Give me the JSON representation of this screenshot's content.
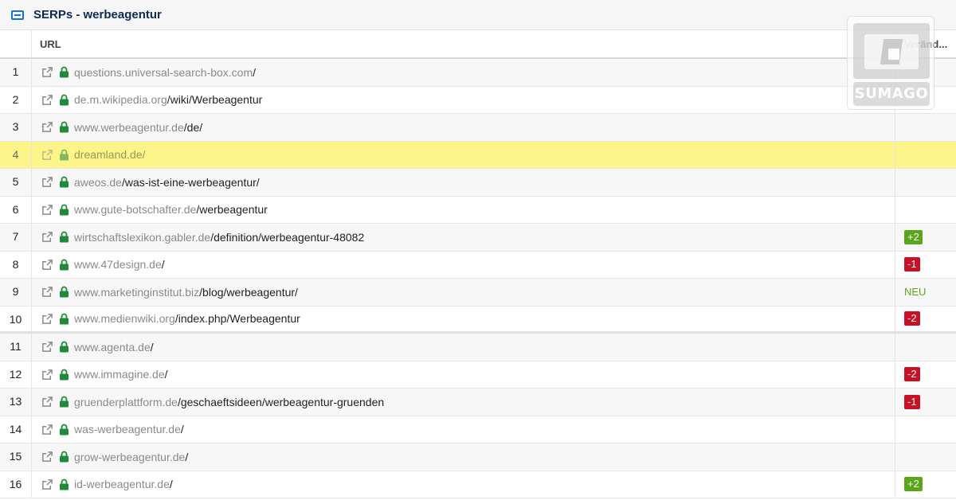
{
  "panel": {
    "title": "SERPs - werbeagentur"
  },
  "table": {
    "columns": {
      "url": "URL",
      "change": "Veränd..."
    },
    "rows": [
      {
        "rank": "1",
        "domain": "questions.universal-search-box.com",
        "path": "/",
        "change": "",
        "change_type": ""
      },
      {
        "rank": "2",
        "domain": "de.m.wikipedia.org",
        "path": "/wiki/Werbeagentur",
        "change": "",
        "change_type": ""
      },
      {
        "rank": "3",
        "domain": "www.werbeagentur.de",
        "path": "/de/",
        "change": "",
        "change_type": ""
      },
      {
        "rank": "4",
        "domain": "dreamland.de",
        "path": "/",
        "change": "",
        "change_type": "",
        "highlighted": true
      },
      {
        "rank": "5",
        "domain": "aweos.de",
        "path": "/was-ist-eine-werbeagentur/",
        "change": "",
        "change_type": ""
      },
      {
        "rank": "6",
        "domain": "www.gute-botschafter.de",
        "path": "/werbeagentur",
        "change": "",
        "change_type": ""
      },
      {
        "rank": "7",
        "domain": "wirtschaftslexikon.gabler.de",
        "path": "/definition/werbeagentur-48082",
        "change": "+2",
        "change_type": "up"
      },
      {
        "rank": "8",
        "domain": "www.47design.de",
        "path": "/",
        "change": "-1",
        "change_type": "down"
      },
      {
        "rank": "9",
        "domain": "www.marketinginstitut.biz",
        "path": "/blog/werbeagentur/",
        "change": "NEU",
        "change_type": "new"
      },
      {
        "rank": "10",
        "domain": "www.medienwiki.org",
        "path": "/index.php/Werbeagentur",
        "change": "-2",
        "change_type": "down"
      },
      {
        "rank": "11",
        "domain": "www.agenta.de",
        "path": "/",
        "change": "",
        "change_type": ""
      },
      {
        "rank": "12",
        "domain": "www.immagine.de",
        "path": "/",
        "change": "-2",
        "change_type": "down"
      },
      {
        "rank": "13",
        "domain": "gruenderplattform.de",
        "path": "/geschaeftsideen/werbeagentur-gruenden",
        "change": "-1",
        "change_type": "down"
      },
      {
        "rank": "14",
        "domain": "was-werbeagentur.de",
        "path": "/",
        "change": "",
        "change_type": ""
      },
      {
        "rank": "15",
        "domain": "grow-werbeagentur.de",
        "path": "/",
        "change": "",
        "change_type": ""
      },
      {
        "rank": "16",
        "domain": "id-werbeagentur.de",
        "path": "/",
        "change": "+2",
        "change_type": "up"
      }
    ]
  },
  "watermark": {
    "text": "SUMAGO"
  },
  "colors": {
    "highlight": "#fdf48a",
    "up": "#5aa61b",
    "down": "#c81127",
    "lock": "#1e8a3a",
    "title": "#0b2a55"
  },
  "icons": {
    "title": "serp-box-icon",
    "external": "external-link-icon",
    "secure": "lock-icon"
  }
}
